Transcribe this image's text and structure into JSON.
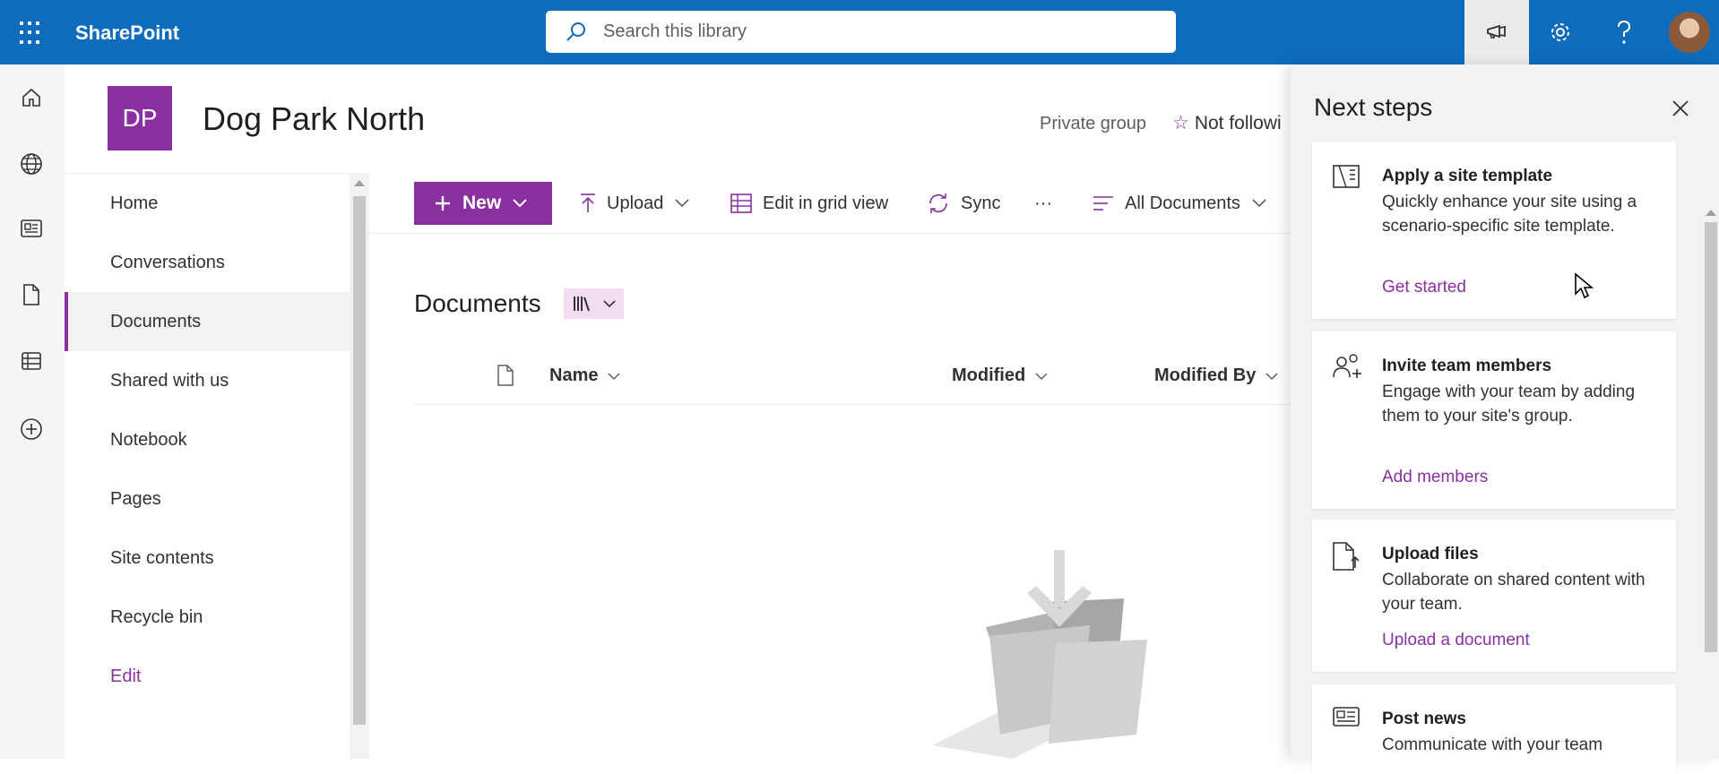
{
  "app": {
    "name": "SharePoint"
  },
  "search": {
    "placeholder": "Search this library"
  },
  "header_icons": [
    "app-launcher-icon",
    "megaphone-icon",
    "gear-icon",
    "help-icon",
    "avatar"
  ],
  "rail_icons": [
    "home-icon",
    "globe-icon",
    "news-icon",
    "file-icon",
    "list-icon",
    "add-icon"
  ],
  "site": {
    "logo_initials": "DP",
    "title": "Dog Park North",
    "group_type": "Private group",
    "follow_label": "Not followi"
  },
  "nav": {
    "items": [
      {
        "label": "Home"
      },
      {
        "label": "Conversations"
      },
      {
        "label": "Documents"
      },
      {
        "label": "Shared with us"
      },
      {
        "label": "Notebook"
      },
      {
        "label": "Pages"
      },
      {
        "label": "Site contents"
      },
      {
        "label": "Recycle bin"
      },
      {
        "label": "Edit"
      }
    ],
    "selected": "Documents"
  },
  "commands": {
    "new": "New",
    "upload": "Upload",
    "grid": "Edit in grid view",
    "sync": "Sync",
    "more": "···",
    "view": "All Documents"
  },
  "library": {
    "title": "Documents",
    "columns": [
      "Name",
      "Modified",
      "Modified By"
    ]
  },
  "panel": {
    "title": "Next steps",
    "cards": [
      {
        "icon": "template-icon",
        "title": "Apply a site template",
        "desc": "Quickly enhance your site using a scenario-specific site template.",
        "link": "Get started"
      },
      {
        "icon": "people-add-icon",
        "title": "Invite team members",
        "desc": "Engage with your team by adding them to your site's group.",
        "link": "Add members"
      },
      {
        "icon": "upload-file-icon",
        "title": "Upload files",
        "desc": "Collaborate on shared content with your team.",
        "link": "Upload a document"
      },
      {
        "icon": "news-icon",
        "title": "Post news",
        "desc": "Communicate with your team"
      }
    ]
  },
  "colors": {
    "suite_bar": "#0f6cbd",
    "accent": "#8a30a0"
  }
}
